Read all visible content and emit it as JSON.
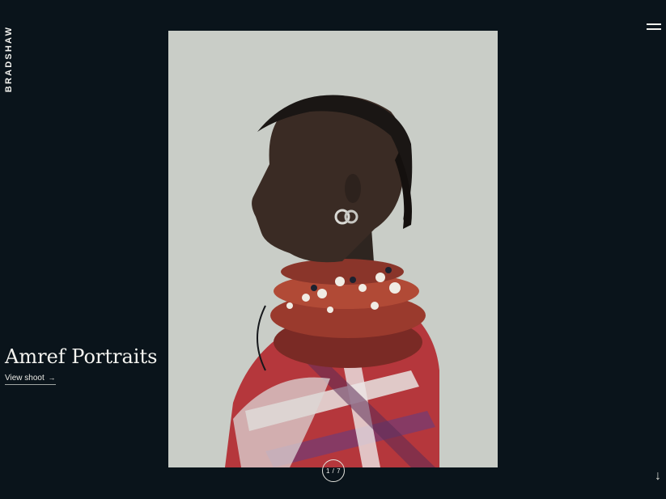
{
  "brand": {
    "name": "BRADSHAW"
  },
  "nav": {
    "menu_icon": "hamburger-icon"
  },
  "project": {
    "title": "Amref Portraits",
    "cta_label": "View shoot",
    "cta_arrow": "→"
  },
  "pager": {
    "label": "1 / 7"
  },
  "scroll": {
    "icon": "arrow-down-icon",
    "glyph": "↓"
  },
  "colors": {
    "background": "#0a141b",
    "photo_backdrop": "#c9cdc7",
    "text": "#f2f2ee"
  }
}
